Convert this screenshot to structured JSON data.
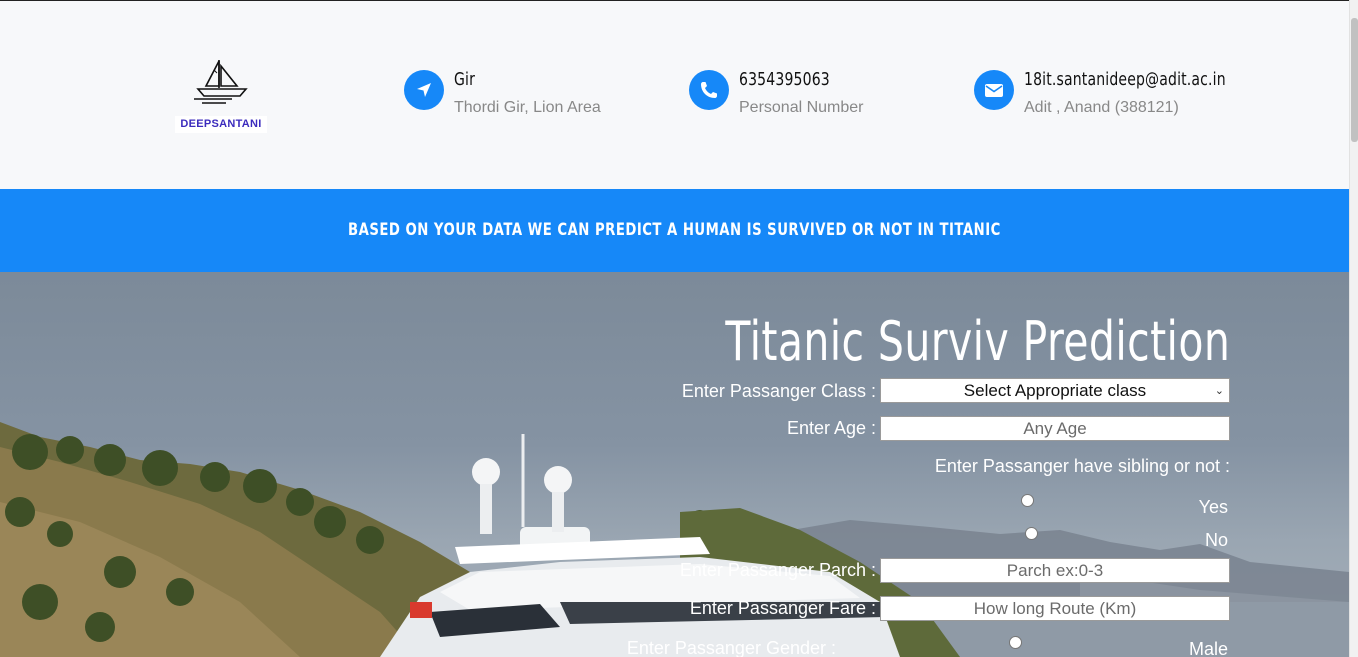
{
  "header": {
    "logo_text": "DEEPSANTANI",
    "contacts": [
      {
        "icon": "location-arrow-icon",
        "title": "Gir",
        "subtitle": "Thordi Gir, Lion Area"
      },
      {
        "icon": "phone-icon",
        "title": "6354395063",
        "subtitle": "Personal Number"
      },
      {
        "icon": "envelope-icon",
        "title": "18it.santanideep@adit.ac.in",
        "subtitle": "Adit , Anand (388121)"
      }
    ]
  },
  "banner": {
    "text": "BASED ON YOUR DATA WE CAN PREDICT A HUMAN IS SURVIVED OR NOT IN TITANIC"
  },
  "form": {
    "title": "Titanic Surviv Prediction",
    "class_label": "Enter Passanger Class :",
    "class_selected": "Select Appropriate class",
    "age_label": "Enter Age :",
    "age_placeholder": "Any Age",
    "sibling_label": "Enter Passanger have sibling or not :",
    "sibling_yes": "Yes",
    "sibling_no": "No",
    "parch_label": "Enter Passanger Parch :",
    "parch_placeholder": "Parch ex:0-3",
    "fare_label": "Enter Passanger Fare :",
    "fare_placeholder": "How long Route (Km)",
    "gender_label": "Enter Passanger Gender :",
    "gender_male": "Male"
  },
  "colors": {
    "accent": "#1688f8",
    "header_bg": "#f7f8fa",
    "logo_text": "#3b2bbd"
  }
}
